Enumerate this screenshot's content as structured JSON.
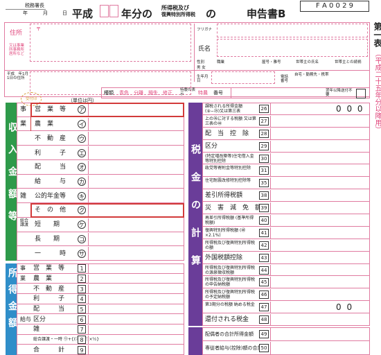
{
  "header": {
    "office_suffix": "税務署長",
    "date_year": "年",
    "date_month": "月",
    "date_day": "日",
    "heisei": "平成",
    "year_suffix": "年分の",
    "tax_line1": "所得税及び",
    "tax_line2": "復興特別所得税",
    "no": "の",
    "title": "申告書B",
    "code": "F A 0 0 2 9"
  },
  "side": {
    "part": "第一表",
    "note": "（平成二十五年分以降用）"
  },
  "info": {
    "address_label": "住所",
    "address_sub": "又は事業所事務所居所など",
    "postal_mark": "〒",
    "furigana": "フリガナ",
    "name_label": "氏名",
    "gender_label": "性別",
    "gender_options": "男 女",
    "occupation": "職業",
    "trade_name": "屋号・雅号",
    "householder": "世帯主の氏名",
    "relation": "世帯主との続柄",
    "jan1_address": "平成　年1月1日の住所",
    "birth": "生年月日",
    "phone": "電話番号",
    "phone_kinds": "自宅・勤務先・携帯"
  },
  "typebar": {
    "stamp": "受付印",
    "unit": "（単位は円）",
    "kind": "種類",
    "options": [
      "青色",
      "分離",
      "損失",
      "修正"
    ],
    "special": "特農の表示",
    "special_value": "特農",
    "number": "番号",
    "stub": "翌年以降送付不要"
  },
  "income": {
    "section": "収入金額等",
    "rows": [
      {
        "main": "事",
        "label": "営　業　等",
        "mark": "ア"
      },
      {
        "main": "業",
        "label": "農　業",
        "mark": "イ"
      },
      {
        "main": "",
        "label": "不　動　産",
        "mark": "ウ"
      },
      {
        "main": "",
        "label": "利　　　子",
        "mark": "エ"
      },
      {
        "main": "",
        "label": "配　　　当",
        "mark": "オ"
      },
      {
        "main": "",
        "label": "給　　　与",
        "mark": "カ"
      },
      {
        "main": "雑",
        "label": "公的年金等",
        "mark": "キ"
      },
      {
        "main": "",
        "label": "そ　の　他",
        "mark": "ク"
      },
      {
        "main": "総合譲渡",
        "label": "短　　期",
        "mark": "ケ"
      },
      {
        "main": "",
        "label": "長　　期",
        "mark": "コ"
      },
      {
        "main": "",
        "label": "一　　　時",
        "mark": "サ"
      }
    ]
  },
  "shotoku": {
    "section": "所得金額",
    "rows": [
      {
        "main": "事",
        "label": "営　業　等",
        "num": "1"
      },
      {
        "main": "業",
        "label": "農　業",
        "num": "2"
      },
      {
        "main": "",
        "label": "不　動　産",
        "num": "3"
      },
      {
        "main": "",
        "label": "利　　　子",
        "num": "4"
      },
      {
        "main": "",
        "label": "配　　　当",
        "num": "5"
      },
      {
        "main": "給与",
        "label": "区分",
        "num": "6"
      },
      {
        "main": "",
        "label": "雑",
        "num": "7"
      },
      {
        "main": "",
        "label": "総合譲渡・一時 ㋒+{(㋓+㋔)×½}",
        "num": "8"
      },
      {
        "main": "",
        "label": "合　　　計",
        "num": "9"
      }
    ]
  },
  "tax": {
    "section": "税金の計算",
    "rows": [
      {
        "label": "課税される所得金額 (⑨−㉕)又は第三表",
        "num": "26",
        "value": "0 0 0"
      },
      {
        "label": "上の㉖に対する税額 又は第三表の㊹",
        "num": "27",
        "value": ""
      },
      {
        "label": "配　当　控　除",
        "num": "28",
        "value": ""
      },
      {
        "label": "区分",
        "num": "29",
        "value": ""
      },
      {
        "label": "(特定増改築等)住宅借入金等特別控除",
        "num": "30",
        "value": ""
      },
      {
        "label": "政党等寄附金等特別控除",
        "num": "31",
        "value": ""
      },
      {
        "label": "住宅耐震改修特別控除等",
        "num": "35",
        "value": ""
      },
      {
        "label": "差引所得税額",
        "num": "38",
        "value": ""
      },
      {
        "label": "災　害　減　免　額",
        "num": "39",
        "value": ""
      },
      {
        "label": "再差引所得税額 (基準所得税額)",
        "num": "40",
        "value": ""
      },
      {
        "label": "復興特別所得税額 (㊵×2.1%)",
        "num": "41",
        "value": ""
      },
      {
        "label": "所得税及び復興特別所得税の額",
        "num": "42",
        "value": ""
      },
      {
        "label": "外国税額控除",
        "num": "43",
        "value": ""
      },
      {
        "label": "所得税及び復興特別所得税の源泉徴収税額",
        "num": "44",
        "value": ""
      },
      {
        "label": "所得税及び復興特別所得税の申告納税額",
        "num": "45",
        "value": ""
      },
      {
        "label": "所得税及び復興特別所得税の予定納税額",
        "num": "46",
        "value": ""
      },
      {
        "label": "第3期分の税額 納める税金",
        "num": "47",
        "value": "0 0"
      },
      {
        "label": "還付される税金",
        "num": "48",
        "value": ""
      }
    ]
  },
  "other": {
    "rows": [
      {
        "label": "配偶者の合計所得金額",
        "num": "49"
      },
      {
        "label": "専従者給与(控除)額の合計額",
        "num": "50"
      }
    ]
  }
}
